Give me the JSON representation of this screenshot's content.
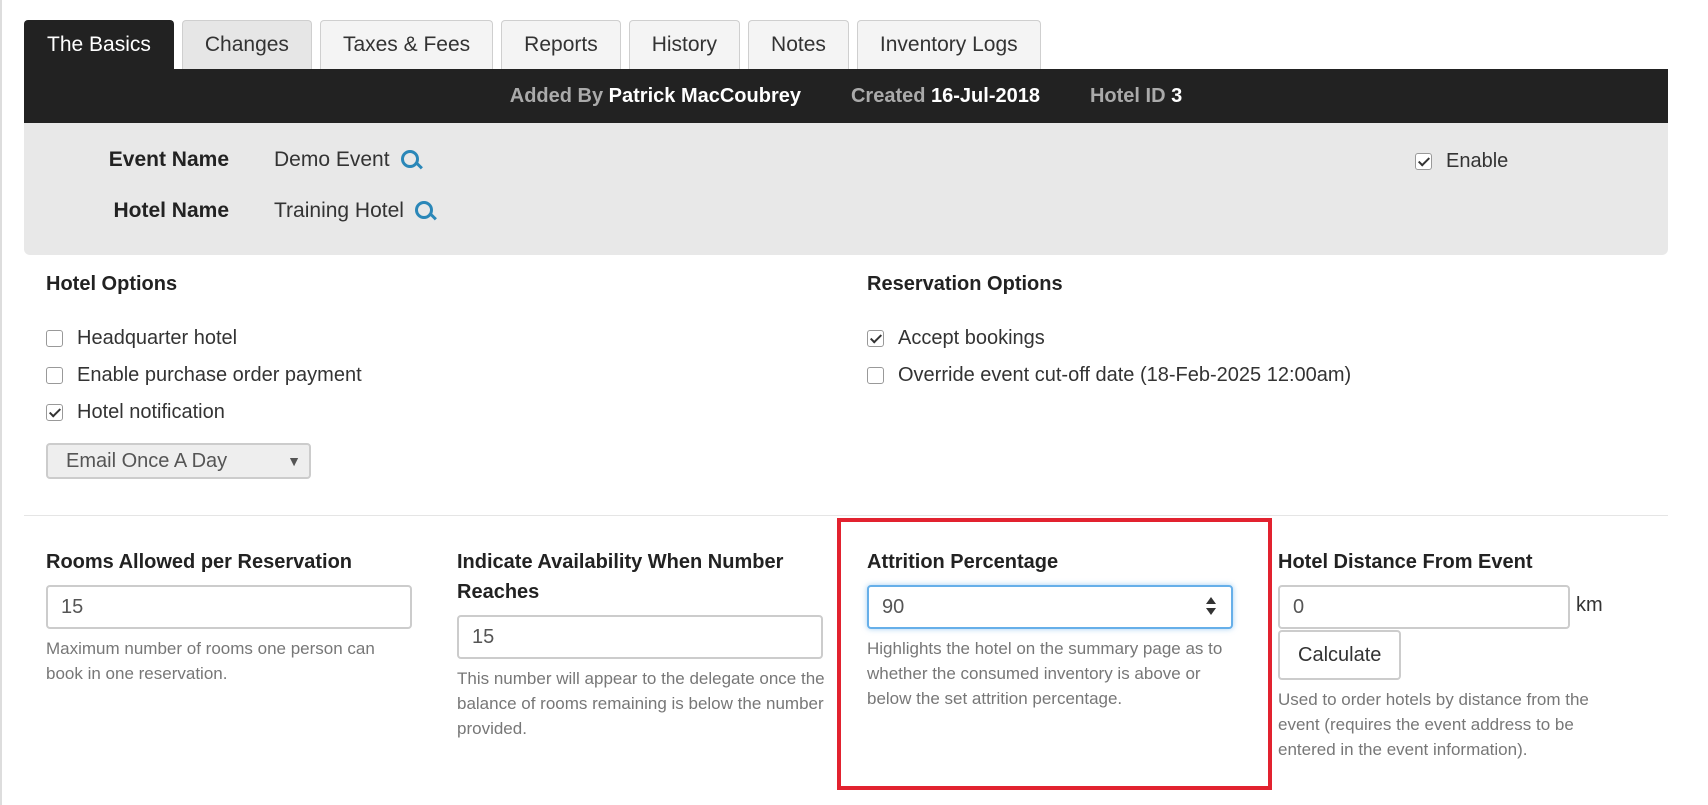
{
  "tabs": [
    {
      "label": "The Basics",
      "state": "active"
    },
    {
      "label": "Changes",
      "state": "grey"
    },
    {
      "label": "Taxes & Fees",
      "state": ""
    },
    {
      "label": "Reports",
      "state": ""
    },
    {
      "label": "History",
      "state": ""
    },
    {
      "label": "Notes",
      "state": ""
    },
    {
      "label": "Inventory Logs",
      "state": ""
    }
  ],
  "infobar": {
    "added_by_label": "Added By",
    "added_by_value": "Patrick MacCoubrey",
    "created_label": "Created",
    "created_value": "16-Jul-2018",
    "hotel_id_label": "Hotel ID",
    "hotel_id_value": "3"
  },
  "event": {
    "event_name_label": "Event Name",
    "event_name_value": "Demo Event",
    "hotel_name_label": "Hotel Name",
    "hotel_name_value": "Training Hotel",
    "enable_label": "Enable",
    "enable_checked": true
  },
  "hotel_options": {
    "title": "Hotel Options",
    "items": [
      {
        "label": "Headquarter hotel",
        "checked": false
      },
      {
        "label": "Enable purchase order payment",
        "checked": false
      },
      {
        "label": "Hotel notification",
        "checked": true
      }
    ],
    "notification_frequency": "Email Once A Day"
  },
  "reservation_options": {
    "title": "Reservation Options",
    "items": [
      {
        "label": "Accept bookings",
        "checked": true
      },
      {
        "label": "Override event cut-off date (18-Feb-2025 12:00am)",
        "checked": false
      }
    ]
  },
  "fields": {
    "rooms_allowed": {
      "label": "Rooms Allowed per Reservation",
      "value": "15",
      "help": "Maximum number of rooms one person can book in one reservation."
    },
    "availability": {
      "label": "Indicate Availability When Number Reaches",
      "value": "15",
      "help": "This number will appear to the delegate once the balance of rooms remaining is below the number provided."
    },
    "attrition": {
      "label": "Attrition Percentage",
      "value": "90",
      "help": "Highlights the hotel on the summary page as to whether the consumed inventory is above or below the set attrition percentage."
    },
    "distance": {
      "label": "Hotel Distance From Event",
      "value": "0",
      "unit": "km",
      "button": "Calculate",
      "help": "Used to order hotels by distance from the event (requires the event address to be entered in the event information)."
    }
  },
  "colors": {
    "highlight": "#e2222f",
    "accent": "#2a87b8"
  }
}
